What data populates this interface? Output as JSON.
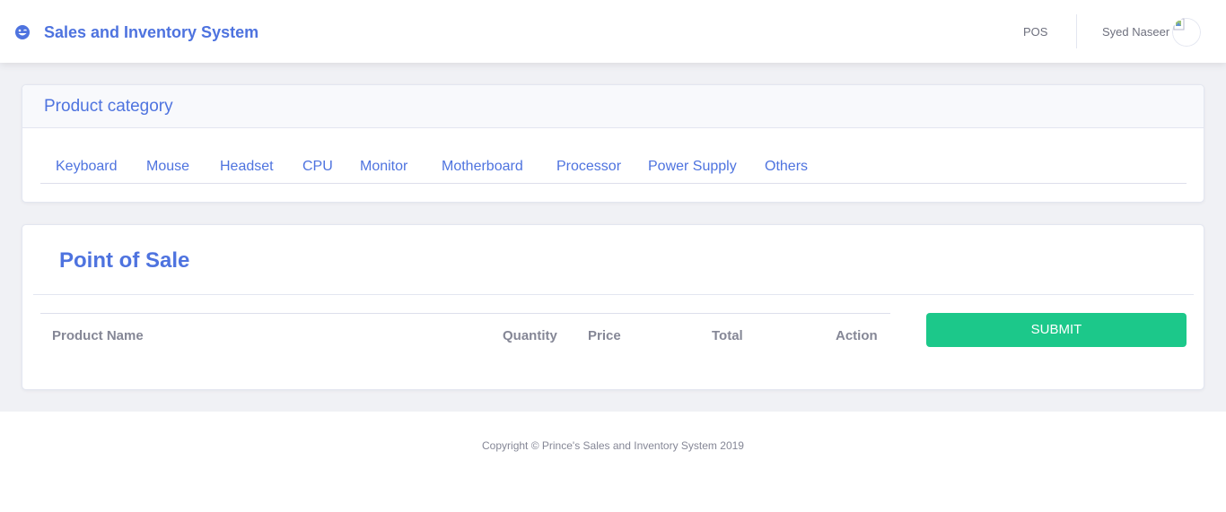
{
  "app": {
    "title": "Sales and Inventory System",
    "icon": "laugh-wink-icon"
  },
  "topbar": {
    "nav_pos": "POS",
    "user_name": "Syed Naseer",
    "avatar_icon": "broken-image-icon"
  },
  "category_card": {
    "title": "Product category",
    "tabs": [
      "Keyboard",
      "Mouse",
      "Headset",
      "CPU",
      "Monitor",
      "Motherboard",
      "Processor",
      "Power Supply",
      "Others"
    ]
  },
  "pos_card": {
    "title": "Point of Sale",
    "columns": [
      "Product Name",
      "Quantity",
      "Price",
      "Total",
      "Action"
    ],
    "submit_label": "SUBMIT"
  },
  "footer": {
    "copyright": "Copyright © Prince's Sales and Inventory System 2019"
  },
  "colors": {
    "primary": "#4e73df",
    "success": "#1cc88a",
    "background": "#f0f1f5",
    "muted_text": "#858796"
  }
}
